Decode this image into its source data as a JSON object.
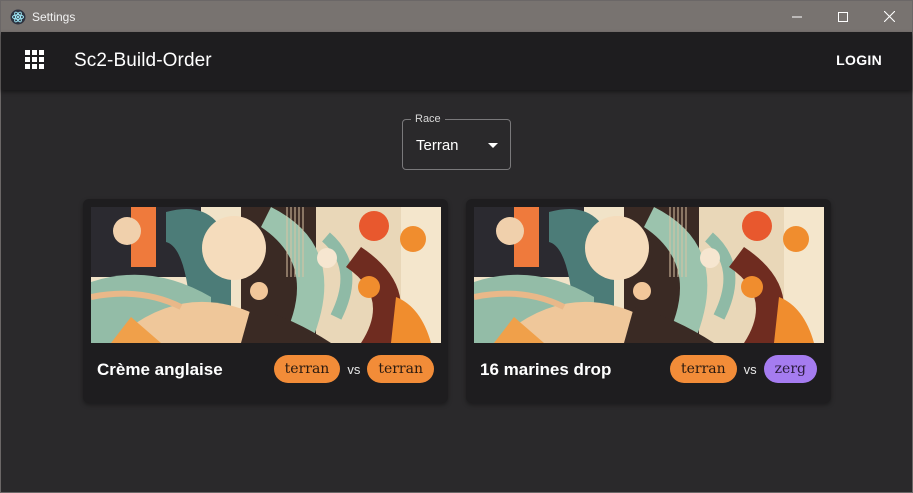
{
  "window": {
    "title": "Settings"
  },
  "appbar": {
    "brand": "Sc2-Build-Order",
    "login_label": "LOGIN"
  },
  "race_select": {
    "label": "Race",
    "value": "Terran"
  },
  "cards": [
    {
      "name": "Crème anglaise",
      "race1": "terran",
      "vs": "vs",
      "race2": "terran"
    },
    {
      "name": "16 marines drop",
      "race1": "terran",
      "vs": "vs",
      "race2": "zerg"
    }
  ],
  "colors": {
    "terran": "#f28c38",
    "zerg": "#a57cf0"
  },
  "icons": {
    "menu": "apps-grid-icon",
    "minimize": "minimize-icon",
    "maximize": "maximize-icon",
    "close": "close-icon",
    "dropdown": "caret-down-icon"
  }
}
